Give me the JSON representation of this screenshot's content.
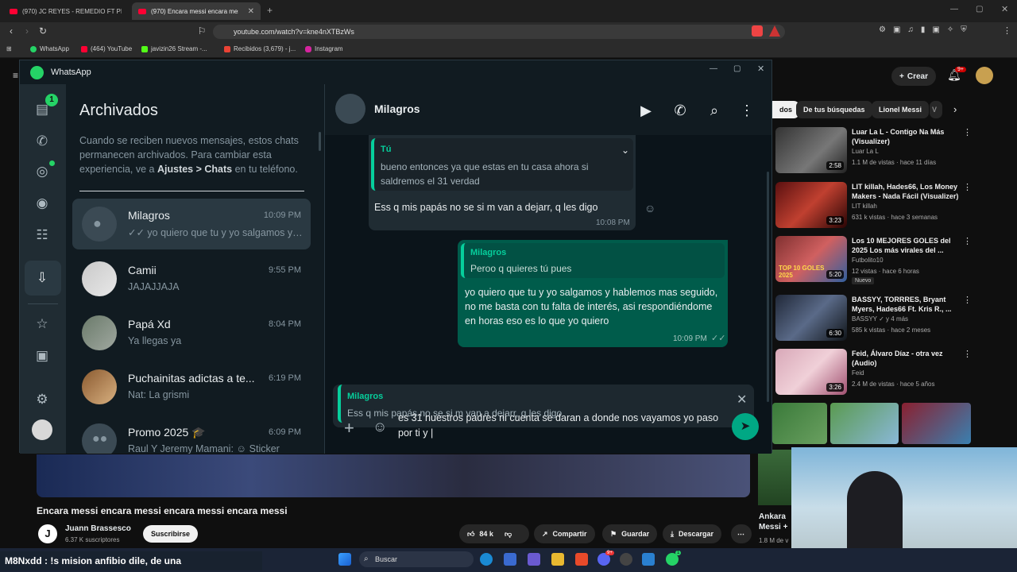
{
  "browser": {
    "tabs": [
      {
        "title": "(970) JC REYES - REMEDIO FT PIRLO"
      },
      {
        "title": "(970) Encara messi encara messi"
      }
    ],
    "url": "youtube.com/watch?v=kne4nXTBzWs",
    "bookmarks": [
      "WhatsApp",
      "(464) YouTube",
      "javizin26 Stream -...",
      "Recibidos (3,679) - j...",
      "Instagram"
    ]
  },
  "youtube": {
    "create_label": "Crear",
    "notif_count": "9+",
    "chips": [
      "dos",
      "De tus búsquedas",
      "Lionel Messi",
      "V"
    ],
    "recs": [
      {
        "title": "Luar La L - Contigo Na Más (Visualizer)",
        "channel": "Luar La L",
        "meta": "1.1 M de vistas · hace 11 días",
        "duration": "2:58"
      },
      {
        "title": "LIT killah, Hades66, Los Money Makers - Nada Fácil (Visualizer)",
        "channel": "LIT killah",
        "meta": "631 k vistas · hace 3 semanas",
        "duration": "3:23"
      },
      {
        "title": "Los 10 MEJORES GOLES del 2025 Los más virales del ...",
        "channel": "Futbolito10",
        "meta": "12 vistas · hace 6 horas",
        "duration": "5:20",
        "badge": "Nuevo",
        "thumb_text": "TOP 10 GOLES 2025"
      },
      {
        "title": "BASSYY, TORRRES, Bryant Myers, Hades66 Ft. Kris R., ...",
        "channel": "BASSYY",
        "channel_extra": "y 4 más",
        "meta": "585 k vistas · hace 2 meses",
        "duration": "6:30"
      },
      {
        "title": "Feid, Álvaro Díaz - otra vez (Audio)",
        "channel": "Feid",
        "meta": "2.4 M de vistas · hace 5 años",
        "duration": "3:26"
      }
    ],
    "partial_rec": {
      "title": "Ankara Messi +",
      "meta": "1.8 M de v"
    },
    "video_title": "Encara messi encara messi encara messi encara messi",
    "channel_name": "Juann Brassesco",
    "channel_initial": "J",
    "subscribers": "6.37 K suscriptores",
    "subscribe_label": "Suscribirse",
    "likes": "84 k",
    "share_label": "Compartir",
    "save_label": "Guardar",
    "download_label": "Descargar"
  },
  "taskbar": {
    "ticker": "M8Nxdd : !s mision anfibio dile, de una",
    "search_placeholder": "Buscar",
    "discord_badge": "9+",
    "wa_badge": "1"
  },
  "whatsapp": {
    "window_title": "WhatsApp",
    "rail_badge": "1",
    "list_title": "Archivados",
    "archived_note_pre": "Cuando se reciben nuevos mensajes, estos chats permanecen archivados. Para cambiar esta experiencia, ve a ",
    "archived_note_bold": "Ajustes > Chats",
    "archived_note_post": " en tu teléfono.",
    "chats": [
      {
        "name": "Milagros",
        "time": "10:09 PM",
        "preview": "✓✓ yo quiero que tu y yo salgamos y ..."
      },
      {
        "name": "Camii",
        "time": "9:55 PM",
        "preview": "JAJAJJAJA"
      },
      {
        "name": "Papá Xd",
        "time": "8:04 PM",
        "preview": "Ya llegas ya"
      },
      {
        "name": "Puchainitas adictas a te...",
        "time": "6:19 PM",
        "preview": "Nat: La grismi"
      },
      {
        "name": "Promo 2025 🎓",
        "time": "6:09 PM",
        "preview": "Raul Y Jeremy Mamani: ☺ Sticker"
      }
    ],
    "contact_name": "Milagros",
    "messages": [
      {
        "quote_author": "Tú",
        "quote_text": "bueno entonces ya que estas en tu casa ahora si saldremos el 31 verdad",
        "text": "Ess q mis papás no se si m van a dejarr, q les digo",
        "time": "10:08 PM"
      },
      {
        "quote_author": "Milagros",
        "quote_text": "Peroo q quieres tú pues",
        "text": "yo quiero que tu y yo salgamos y hablemos mas seguido, no me basta con tu falta de interés, asi respondiéndome en horas eso es lo que yo quiero",
        "time": "10:09 PM"
      }
    ],
    "reply": {
      "author": "Milagros",
      "text": "Ess q mis papás no se si m van a dejarr, q les digo"
    },
    "draft": "es 31 nuestros padres ni cuenta se daran a donde nos vayamos yo paso por ti y |"
  },
  "colors": {
    "wa_green": "#06cf9c",
    "out_bubble": "#005c4b",
    "in_bubble": "#202c33",
    "yt_red": "#ff0033",
    "send": "#00a884"
  }
}
